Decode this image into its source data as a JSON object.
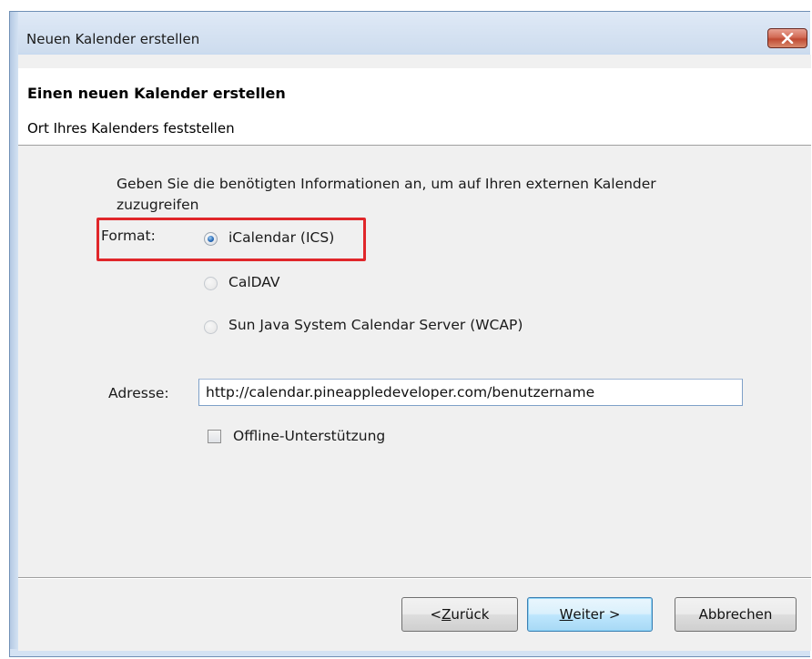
{
  "window": {
    "title": "Neuen Kalender erstellen"
  },
  "header": {
    "title": "Einen neuen Kalender erstellen",
    "subtitle": "Ort Ihres Kalenders feststellen"
  },
  "main": {
    "info_text": "Geben Sie die benötigten Informationen an, um auf Ihren externen Kalender zuzugreifen",
    "format_label": "Format:",
    "format_options": [
      {
        "label": "iCalendar (ICS)",
        "selected": true
      },
      {
        "label": "CalDAV",
        "selected": false
      },
      {
        "label": "Sun Java System Calendar Server (WCAP)",
        "selected": false
      }
    ],
    "address_label": "Adresse:",
    "address_value": "http://calendar.pineappledeveloper.com/benutzername",
    "offline_label": "Offline-Unterstützung",
    "offline_checked": false
  },
  "footer": {
    "back_prefix": "< ",
    "back_mnemonic": "Z",
    "back_rest": "urück",
    "next_mnemonic": "W",
    "next_rest": "eiter >",
    "cancel_label": "Abbrechen"
  },
  "colors": {
    "highlight": "#e0262a",
    "frame": "#c9daef",
    "close_button": "#c04a33"
  },
  "icons": {
    "close": "close-icon"
  }
}
